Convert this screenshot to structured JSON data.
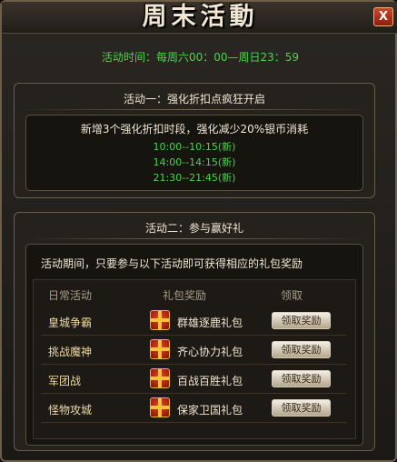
{
  "window": {
    "title": "周末活動",
    "close_label": "X"
  },
  "event_time": "活动时间：每周六00：00—周日23：59",
  "activity1": {
    "title": "活动一：强化折扣点疯狂开启",
    "description": "新增3个强化折扣时段，强化减少20%银币消耗",
    "time_slots": [
      "10:00--10:15(新)",
      "14:00--14:15(新)",
      "21:30--21:45(新)"
    ]
  },
  "activity2": {
    "title": "活动二：参与赢好礼",
    "note": "活动期间，只要参与以下活动即可获得相应的礼包奖励",
    "headers": {
      "activity": "日常活动",
      "reward": "礼包奖励",
      "claim": "领取"
    },
    "rows": [
      {
        "activity": "皇城争霸",
        "gift": "群雄逐鹿礼包",
        "button": "领取奖励"
      },
      {
        "activity": "挑战魔神",
        "gift": "齐心协力礼包",
        "button": "领取奖励"
      },
      {
        "activity": "军团战",
        "gift": "百战百胜礼包",
        "button": "领取奖励"
      },
      {
        "activity": "怪物攻城",
        "gift": "保家卫国礼包",
        "button": "领取奖励"
      }
    ]
  },
  "colors": {
    "highlight_green": "#49d44a",
    "gold_text": "#f0d9a0",
    "frame": "#6e5e48"
  },
  "icons": {
    "close": "close-icon",
    "gift": "gift-box-icon"
  }
}
